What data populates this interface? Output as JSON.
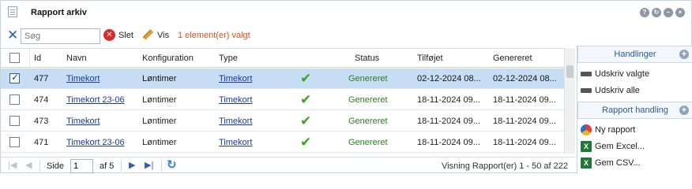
{
  "window": {
    "title": "Rapport arkiv",
    "buttons": [
      "?",
      "↻",
      "−",
      "×"
    ]
  },
  "toolbar": {
    "search_placeholder": "Søg",
    "delete_label": "Slet",
    "view_label": "Vis",
    "selected_count": "1 element(er) valgt"
  },
  "grid": {
    "columns": {
      "id": "Id",
      "name": "Navn",
      "configuration": "Konfiguration",
      "type": "Type",
      "status": "Status",
      "added": "Tilføjet",
      "generated": "Genereret"
    },
    "rows": [
      {
        "checked": true,
        "id": "477",
        "name": "Timekort",
        "configuration": "Løntimer",
        "type": "Timekort",
        "status": "Genereret",
        "added": "02-12-2024 08...",
        "generated": "02-12-2024 08..."
      },
      {
        "checked": false,
        "id": "474",
        "name": "Timekort 23-06",
        "configuration": "Løntimer",
        "type": "Timekort",
        "status": "Genereret",
        "added": "18-11-2024 09...",
        "generated": "18-11-2024 09..."
      },
      {
        "checked": false,
        "id": "473",
        "name": "Timekort",
        "configuration": "Løntimer",
        "type": "Timekort",
        "status": "Genereret",
        "added": "18-11-2024 09...",
        "generated": "18-11-2024 09..."
      },
      {
        "checked": false,
        "id": "471",
        "name": "Timekort 23-06",
        "configuration": "Løntimer",
        "type": "Timekort",
        "status": "Genereret",
        "added": "18-11-2024 09...",
        "generated": "18-11-2024 09..."
      }
    ]
  },
  "pager": {
    "page_label": "Side",
    "page_value": "1",
    "of_label": "af 5",
    "display_info": "Visning Rapport(er) 1 - 50 af 222"
  },
  "side": {
    "actions_title": "Handlinger",
    "actions": [
      "Udskriv valgte",
      "Udskriv alle"
    ],
    "report_title": "Rapport handling",
    "report_actions": [
      "Ny rapport",
      "Gem Excel...",
      "Gem CSV..."
    ]
  },
  "colors": {
    "accent": "#2c5d96",
    "selected_row": "#c7ddf4",
    "status_green": "#2e7d22",
    "count_orange": "#d9531e"
  }
}
